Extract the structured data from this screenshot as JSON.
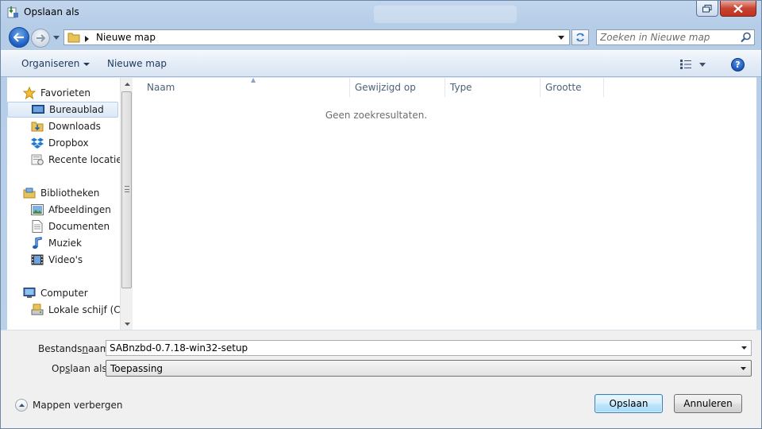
{
  "window": {
    "title": "Opslaan als"
  },
  "address": {
    "path": "Nieuwe map",
    "search_placeholder": "Zoeken in Nieuwe map"
  },
  "toolbar": {
    "organize_label": "Organiseren",
    "new_folder_label": "Nieuwe map"
  },
  "nav": {
    "favorites": "Favorieten",
    "desktop": "Bureaublad",
    "downloads": "Downloads",
    "dropbox": "Dropbox",
    "recent": "Recente locaties",
    "libraries": "Bibliotheken",
    "pictures": "Afbeeldingen",
    "documents": "Documenten",
    "music": "Muziek",
    "videos": "Video's",
    "computer": "Computer",
    "local_disk": "Lokale schijf (C:)"
  },
  "columns": {
    "name": "Naam",
    "modified": "Gewijzigd op",
    "type": "Type",
    "size": "Grootte"
  },
  "file_list": {
    "empty_message": "Geen zoekresultaten."
  },
  "form": {
    "filename_label_pre": "Bestands",
    "filename_label_u": "n",
    "filename_label_post": "aam:",
    "filename_value": "SABnzbd-0.7.18-win32-setup",
    "savetype_label_pre": "Op",
    "savetype_label_u": "s",
    "savetype_label_post": "laan als:",
    "savetype_value": "Toepassing"
  },
  "footer": {
    "hide_folders": "Mappen verbergen",
    "save_button": "Opslaan",
    "cancel_button": "Annuleren"
  },
  "colors": {
    "accent": "#1b5ec2",
    "selection": "#dbe8f7",
    "close_button": "#c84432"
  }
}
